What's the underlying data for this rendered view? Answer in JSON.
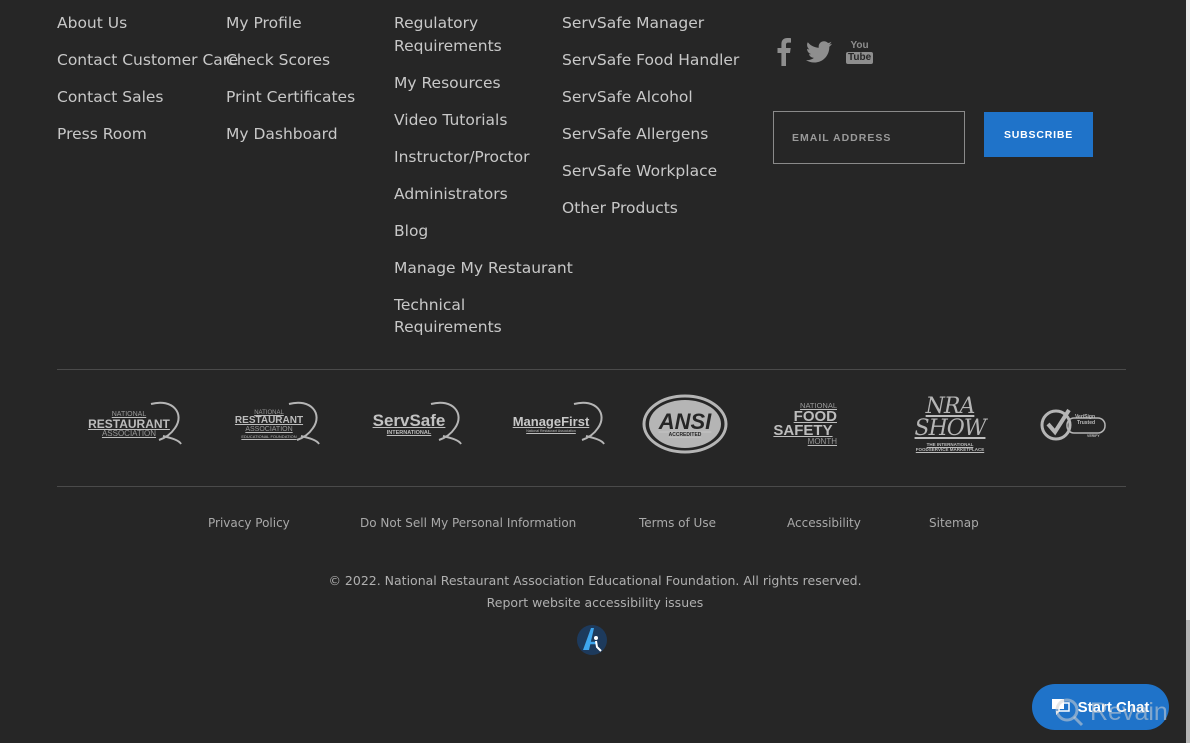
{
  "footer_links": {
    "col1": [
      "About Us",
      "Contact Customer Care",
      "Contact Sales",
      "Press Room"
    ],
    "col2": [
      "My Profile",
      "Check Scores",
      "Print Certificates",
      "My Dashboard"
    ],
    "col3": [
      "Regulatory Requirements",
      "My Resources",
      "Video Tutorials",
      "Instructor/Proctor",
      "Administrators",
      "Blog",
      "Manage My Restaurant",
      "Technical Requirements"
    ],
    "col4": [
      "ServSafe Manager",
      "ServSafe Food Handler",
      "ServSafe Alcohol",
      "ServSafe Allergens",
      "ServSafe Workplace",
      "Other Products"
    ]
  },
  "social": {
    "icons": [
      "facebook-icon",
      "twitter-icon",
      "youtube-icon"
    ],
    "youtube_text_top": "You",
    "youtube_text_bottom": "Tube"
  },
  "newsletter": {
    "email_placeholder": "EMAIL ADDRESS",
    "email_value": "",
    "subscribe_label": "SUBSCRIBE"
  },
  "partner_logos": {
    "nra": {
      "line1": "NATIONAL",
      "line2": "RESTAURANT",
      "line3": "ASSOCIATION"
    },
    "nraef": {
      "line1": "NATIONAL",
      "line2": "RESTAURANT",
      "line3": "ASSOCIATION",
      "line4": "EDUCATIONAL FOUNDATION"
    },
    "servsafe": {
      "line1": "ServSafe",
      "line2": "INTERNATIONAL"
    },
    "managefirst": {
      "line1": "ManageFirst",
      "line2": "National Restaurant Association"
    },
    "ansi": {
      "line1": "ANSI",
      "line2": "ACCREDITED"
    },
    "food_safety": {
      "line1": "NATIONAL",
      "line2": "FOOD",
      "line3": "SAFETY",
      "line4": "MONTH"
    },
    "nra_show": {
      "line1": "NRA SHOW",
      "line2": "THE INTERNATIONAL",
      "line3": "FOODSERVICE MARKETPLACE"
    },
    "verisign": {
      "line1": "VeriSign",
      "line2": "Trusted",
      "line3": "VERIFY"
    }
  },
  "legal_links": [
    "Privacy Policy",
    "Do Not Sell My Personal Information",
    "Terms of Use",
    "Accessibility",
    "Sitemap"
  ],
  "copyright": "© 2022. National Restaurant Association Educational Foundation. All rights reserved.",
  "report_link": "Report website accessibility issues",
  "chat": {
    "label": "Start Chat"
  },
  "watermark": "Revain",
  "colors": {
    "background": "#262626",
    "accent": "#1f73c9",
    "text": "#c8c8c8"
  }
}
